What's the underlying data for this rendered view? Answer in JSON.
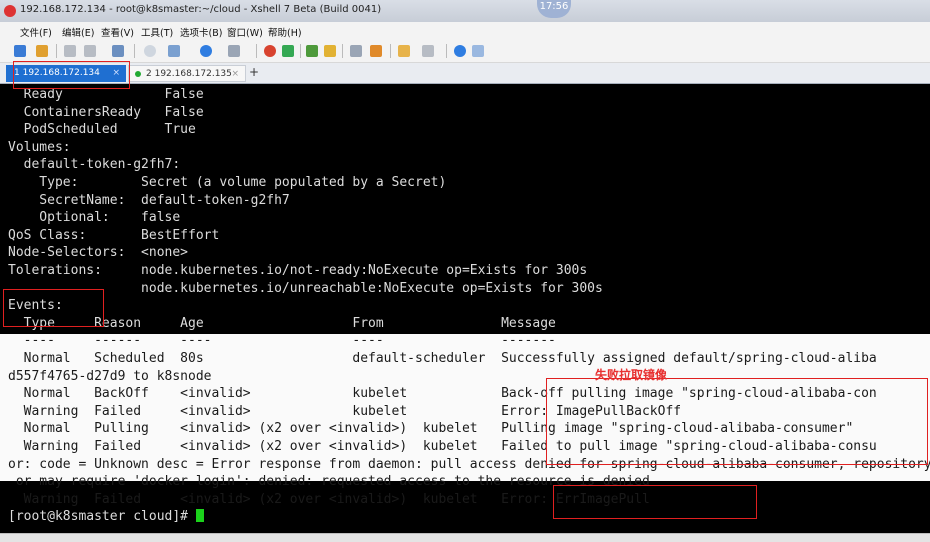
{
  "window": {
    "title": "192.168.172.134 - root@k8smaster:~/cloud - Xshell 7 Beta (Build 0041)",
    "clock": "17:56"
  },
  "menu": [
    "文件(F)",
    "编辑(E)",
    "查看(V)",
    "工具(T)",
    "选项卡(B)",
    "窗口(W)",
    "帮助(H)"
  ],
  "tabs": [
    {
      "label": "1 192.168.172.134",
      "close": "×"
    },
    {
      "label": "2 192.168.172.135",
      "close": "×"
    }
  ],
  "tab_add": "+",
  "terminal": {
    "lines": [
      "  Ready             False",
      "  ContainersReady   False",
      "  PodScheduled      True",
      "Volumes:",
      "  default-token-g2fh7:",
      "    Type:        Secret (a volume populated by a Secret)",
      "    SecretName:  default-token-g2fh7",
      "    Optional:    false",
      "QoS Class:       BestEffort",
      "Node-Selectors:  <none>",
      "Tolerations:     node.kubernetes.io/not-ready:NoExecute op=Exists for 300s",
      "                 node.kubernetes.io/unreachable:NoExecute op=Exists for 300s",
      "Events:",
      "  Type     Reason     Age                   From               Message",
      "  ----     ------     ----                  ----               -------",
      "  Normal   Scheduled  80s                   default-scheduler  Successfully assigned default/spring-cloud-aliba",
      "d557f4765-d27d9 to k8snode",
      "  Normal   BackOff    <invalid>             kubelet            Back-off pulling image \"spring-cloud-alibaba-con",
      "  Warning  Failed     <invalid>             kubelet            Error: ImagePullBackOff",
      "  Normal   Pulling    <invalid> (x2 over <invalid>)  kubelet   Pulling image \"spring-cloud-alibaba-consumer\"",
      "  Warning  Failed     <invalid> (x2 over <invalid>)  kubelet   Failed to pull image \"spring-cloud-alibaba-consu",
      "or: code = Unknown desc = Error response from daemon: pull access denied for spring-cloud-alibaba-consumer, repository d",
      " or may require 'docker login': denied: requested access to the resource is denied",
      "  Warning  Failed     <invalid> (x2 over <invalid>)  kubelet   Error: ErrImagePull",
      "[root@k8smaster cloud]# "
    ],
    "annotation": "失败拉取镜像"
  },
  "colors": {
    "annotation": "#e83030",
    "cursor": "#1bd21b",
    "tab_active": "#1f6fd1"
  }
}
